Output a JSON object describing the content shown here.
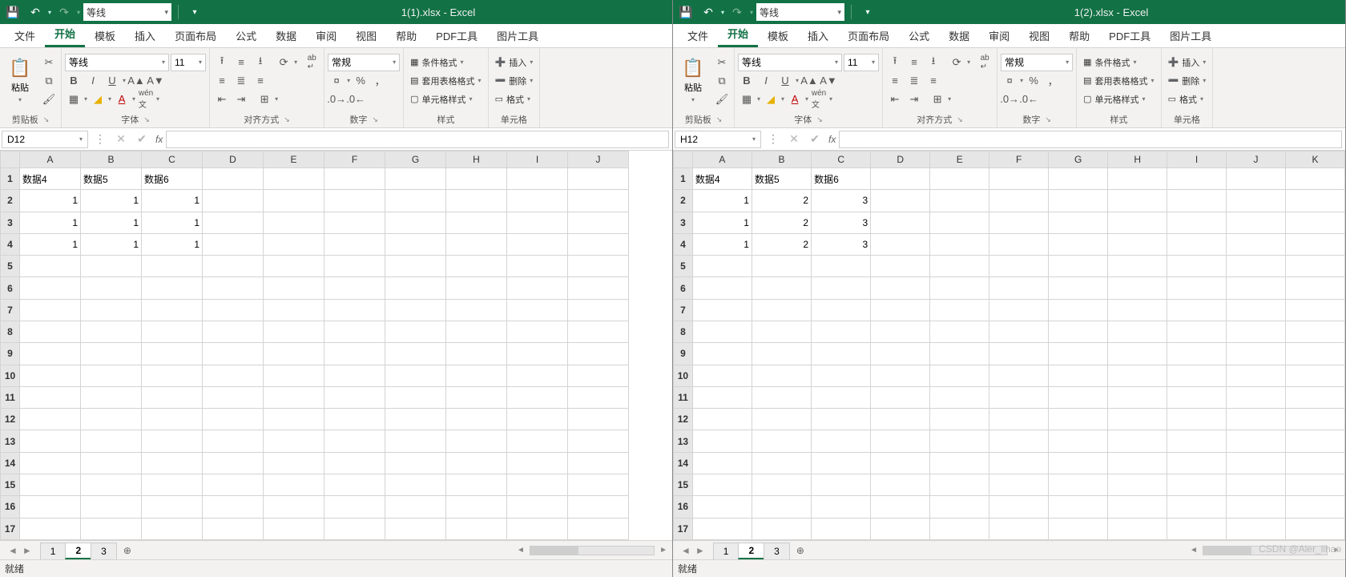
{
  "watermark": "CSDN @Aler_lihao",
  "ribbon_tabs": [
    "文件",
    "开始",
    "模板",
    "插入",
    "页面布局",
    "公式",
    "数据",
    "审阅",
    "视图",
    "帮助",
    "PDF工具",
    "图片工具"
  ],
  "ribbon_active": "开始",
  "groups": {
    "clipboard": "剪贴板",
    "font": "字体",
    "align": "对齐方式",
    "number": "数字",
    "style": "样式",
    "cells": "单元格",
    "paste": "粘贴",
    "cond_format": "条件格式",
    "table_format": "套用表格格式",
    "cell_style": "单元格样式",
    "insert": "插入",
    "delete": "删除",
    "format": "格式",
    "number_general": "常规"
  },
  "font": {
    "name": "等线",
    "size": "11"
  },
  "windows": [
    {
      "title": "1(1).xlsx  -  Excel",
      "qat_font": "等线",
      "namebox": "D12",
      "status": "就绪",
      "sheet_tabs": [
        "1",
        "2",
        "3"
      ],
      "sheet_active": "2",
      "columns": [
        "A",
        "B",
        "C",
        "D",
        "E",
        "F",
        "G",
        "H",
        "I",
        "J"
      ],
      "rows": [
        "1",
        "2",
        "3",
        "4",
        "5",
        "6",
        "7",
        "8",
        "9",
        "10",
        "11",
        "12",
        "13",
        "14",
        "15",
        "16",
        "17"
      ],
      "cells": {
        "A1": {
          "v": "数据4",
          "t": "text"
        },
        "B1": {
          "v": "数据5",
          "t": "text"
        },
        "C1": {
          "v": "数据6",
          "t": "text"
        },
        "A2": {
          "v": "1",
          "t": "num"
        },
        "B2": {
          "v": "1",
          "t": "num"
        },
        "C2": {
          "v": "1",
          "t": "num"
        },
        "A3": {
          "v": "1",
          "t": "num"
        },
        "B3": {
          "v": "1",
          "t": "num"
        },
        "C3": {
          "v": "1",
          "t": "num"
        },
        "A4": {
          "v": "1",
          "t": "num"
        },
        "B4": {
          "v": "1",
          "t": "num"
        },
        "C4": {
          "v": "1",
          "t": "num"
        }
      }
    },
    {
      "title": "1(2).xlsx  -  Excel",
      "qat_font": "等线",
      "namebox": "H12",
      "status": "就绪",
      "sheet_tabs": [
        "1",
        "2",
        "3"
      ],
      "sheet_active": "2",
      "columns": [
        "A",
        "B",
        "C",
        "D",
        "E",
        "F",
        "G",
        "H",
        "I",
        "J",
        "K"
      ],
      "rows": [
        "1",
        "2",
        "3",
        "4",
        "5",
        "6",
        "7",
        "8",
        "9",
        "10",
        "11",
        "12",
        "13",
        "14",
        "15",
        "16",
        "17"
      ],
      "cells": {
        "A1": {
          "v": "数据4",
          "t": "text"
        },
        "B1": {
          "v": "数据5",
          "t": "text"
        },
        "C1": {
          "v": "数据6",
          "t": "text"
        },
        "A2": {
          "v": "1",
          "t": "num"
        },
        "B2": {
          "v": "2",
          "t": "num"
        },
        "C2": {
          "v": "3",
          "t": "num"
        },
        "A3": {
          "v": "1",
          "t": "num"
        },
        "B3": {
          "v": "2",
          "t": "num"
        },
        "C3": {
          "v": "3",
          "t": "num"
        },
        "A4": {
          "v": "1",
          "t": "num"
        },
        "B4": {
          "v": "2",
          "t": "num"
        },
        "C4": {
          "v": "3",
          "t": "num"
        }
      }
    }
  ]
}
